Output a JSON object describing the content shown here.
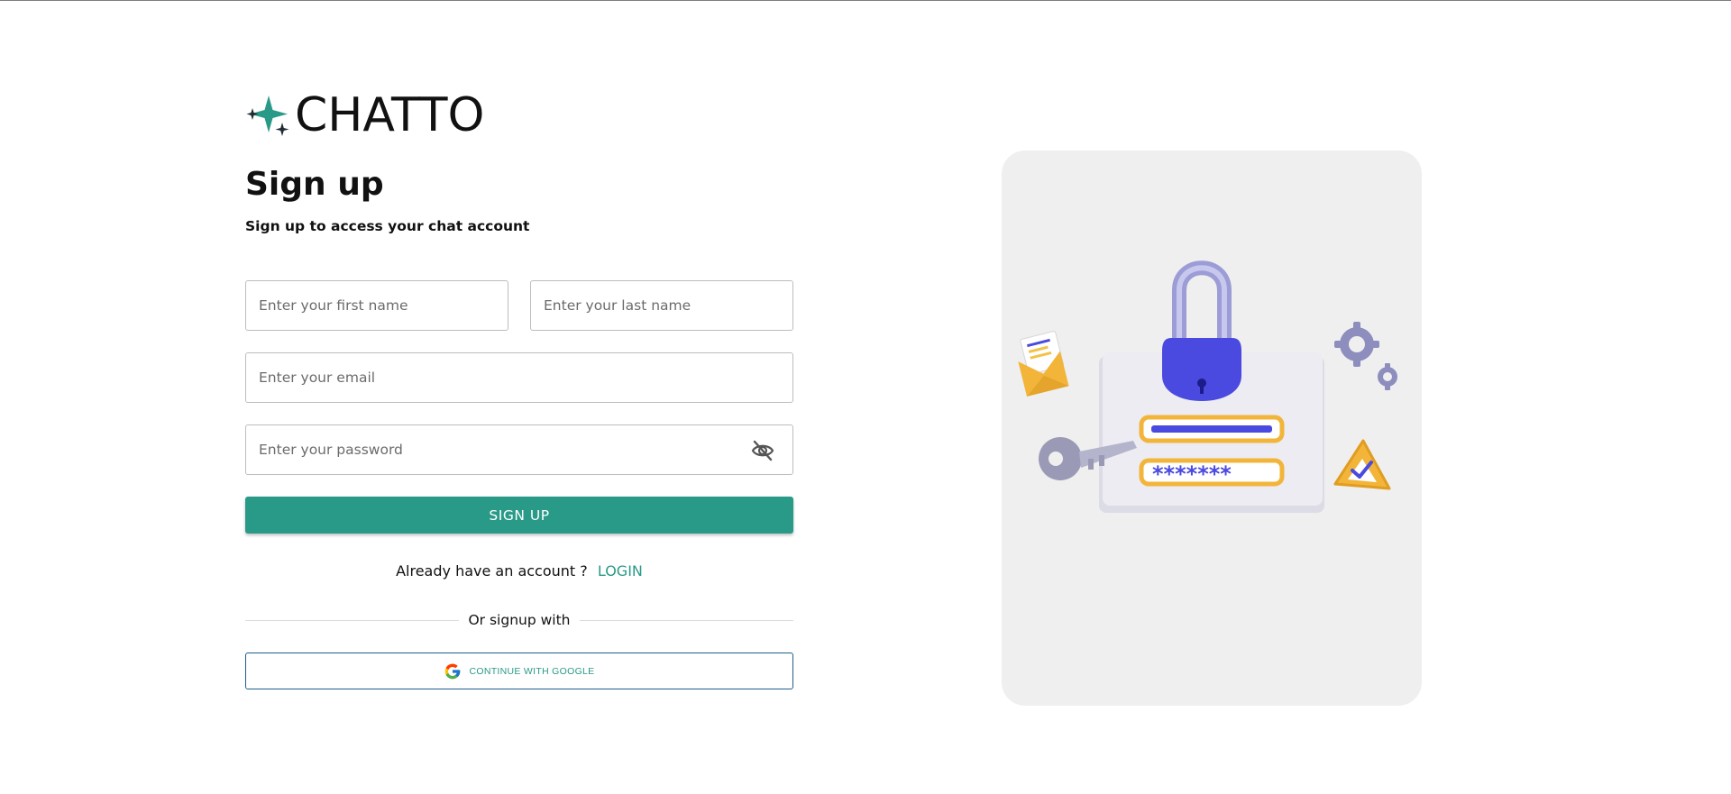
{
  "brand": {
    "name": "CHATTO",
    "accent": "#2a9a88"
  },
  "heading": {
    "title": "Sign up",
    "subtitle": "Sign up to access your chat account"
  },
  "form": {
    "first_name_placeholder": "Enter your first name",
    "last_name_placeholder": "Enter your last name",
    "email_placeholder": "Enter your email",
    "password_placeholder": "Enter your password",
    "password_toggle_icon": "eye-off-icon",
    "submit_label": "SIGN UP"
  },
  "login_prompt": {
    "text": "Already have an account ?",
    "link_label": "LOGIN"
  },
  "divider": {
    "text": "Or signup with"
  },
  "social": {
    "google_label": "CONTINUE WITH GOOGLE",
    "google_icon": "google-icon"
  },
  "illustration": {
    "icon": "padlock-login-illustration"
  }
}
